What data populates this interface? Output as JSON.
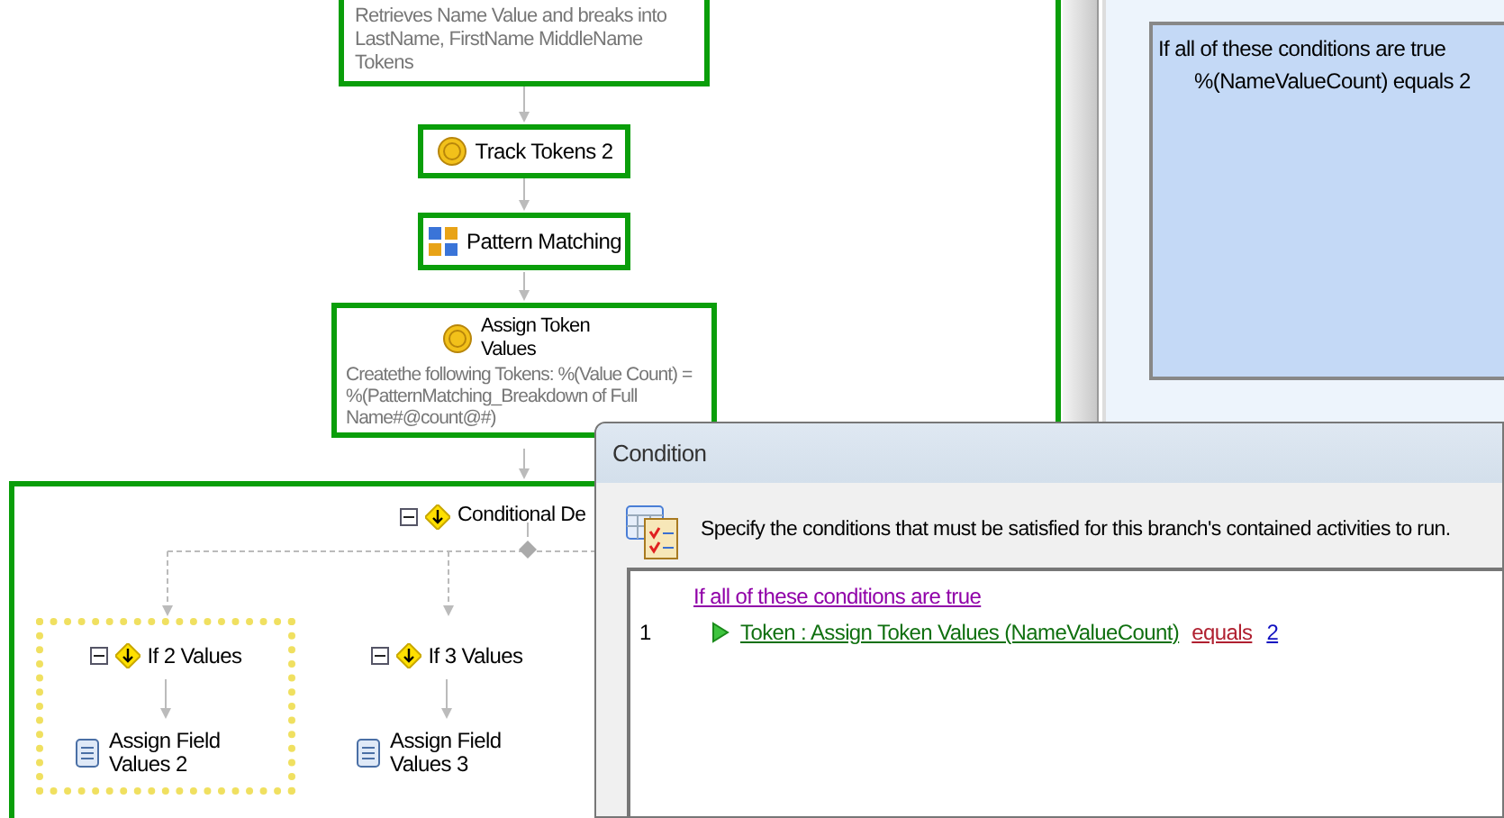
{
  "designer": {
    "activities": [
      {
        "kind": "cut",
        "description": "Retrieves Name Value and breaks into LastName, FirstName MiddleName Tokens"
      },
      {
        "kind": "simple",
        "title": "Track Tokens 2"
      },
      {
        "kind": "simple",
        "title": "Pattern Matching"
      },
      {
        "kind": "detailed",
        "title": "Assign Token Values",
        "description": "Createthe following Tokens: %(Value Count) = %(PatternMatching_Breakdown of Full Name#@count@#)"
      }
    ],
    "conditional": {
      "title": "Conditional De",
      "expanded": true,
      "branches": [
        {
          "title": "If 2 Values",
          "selected": true,
          "expanded": true,
          "activity": "Assign Field Values 2"
        },
        {
          "title": "If 3 Values",
          "selected": false,
          "expanded": true,
          "activity": "Assign Field Values 3"
        }
      ]
    }
  },
  "properties_panel": {
    "summary": "If all of these conditions are true",
    "condition": "%(NameValueCount) equals 2"
  },
  "dialog": {
    "title": "Condition",
    "instruction": "Specify the conditions that must be satisfied for this branch's contained activities to run.",
    "header_link": "If all of these conditions are true",
    "rows": [
      {
        "number": "1",
        "operand": "Token : Assign Token Values (NameValueCount)",
        "operator": "equals",
        "value": "2"
      }
    ]
  }
}
